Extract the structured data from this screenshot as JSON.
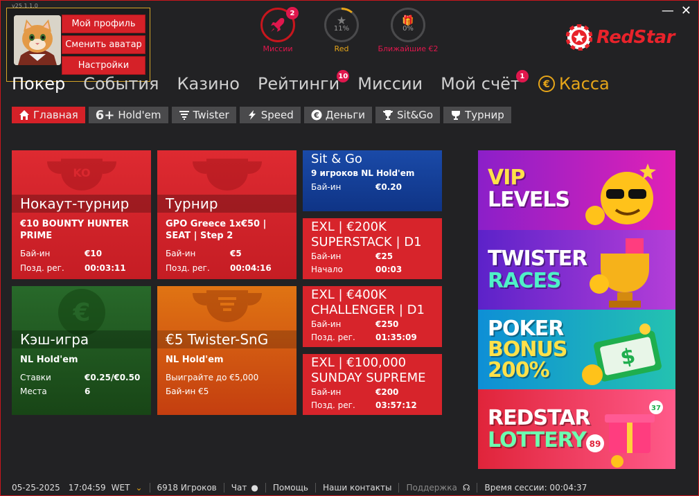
{
  "version": "v25.1.1.0",
  "profile": {
    "my_profile": "Мой профиль",
    "change_avatar": "Сменить аватар",
    "settings": "Настройки"
  },
  "top_stats": [
    {
      "label": "Миссии",
      "badge": "2",
      "color": "#e0174d"
    },
    {
      "label": "Red",
      "center": "11%",
      "progress": 0.11,
      "color": "#e6a519"
    },
    {
      "label": "Ближайшие €2",
      "center": "0%",
      "progress": 0.0,
      "color": "#e0174d"
    }
  ],
  "logo": "RedStar",
  "main_nav": {
    "poker": "Покер",
    "events": "События",
    "casino": "Казино",
    "ratings": "Рейтинги",
    "ratings_badge": "10",
    "missions": "Миссии",
    "account": "Мой счёт",
    "account_badge": "1",
    "kassa": "Касса"
  },
  "sub_nav": [
    "Главная",
    "Hold'em",
    "Twister",
    "Speed",
    "Деньги",
    "Sit&Go",
    "Турнир"
  ],
  "sub_nav_icons": [
    "home-icon",
    "six-plus-icon",
    "twister-icon",
    "lightning-icon",
    "euro-coin-icon",
    "trophy-icon",
    "cup-icon"
  ],
  "cards": {
    "knockout": {
      "title": "Нокаут-турнир",
      "sub": "€10 BOUNTY HUNTER PRIME",
      "rows": [
        {
          "k": "Бай-ин",
          "v": "€10"
        },
        {
          "k": "Позд. рег.",
          "v": "00:03:11"
        }
      ]
    },
    "tournament": {
      "title": "Турнир",
      "sub": "GPO Greece 1x€50 | SEAT | Step 2",
      "rows": [
        {
          "k": "Бай-ин",
          "v": "€5"
        },
        {
          "k": "Позд. рег.",
          "v": "00:04:16"
        }
      ]
    },
    "cash": {
      "title": "Кэш-игра",
      "sub": "NL Hold'em",
      "rows": [
        {
          "k": "Ставки",
          "v": "€0.25/€0.50"
        },
        {
          "k": "Места",
          "v": "6"
        }
      ]
    },
    "twister": {
      "title": "€5 Twister-SnG",
      "sub": "NL Hold'em",
      "line1": "Выиграйте до €5,000",
      "line2": "Бай-ин €5"
    }
  },
  "small_cards": [
    {
      "title": "Sit & Go",
      "sub": "9 игроков NL Hold'em",
      "rows": [
        {
          "k": "Бай-ин",
          "v": "€0.20"
        }
      ]
    },
    {
      "title": "EXL | €200K SUPERSTACK | D1",
      "rows": [
        {
          "k": "Бай-ин",
          "v": "€25"
        },
        {
          "k": "Начало",
          "v": "00:03"
        }
      ]
    },
    {
      "title": "EXL | €400K CHALLENGER | D1",
      "rows": [
        {
          "k": "Бай-ин",
          "v": "€250"
        },
        {
          "k": "Позд. рег.",
          "v": "01:35:09"
        }
      ]
    },
    {
      "title": "EXL | €100,000 SUNDAY SUPREME",
      "rows": [
        {
          "k": "Бай-ин",
          "v": "€200"
        },
        {
          "k": "Позд. рег.",
          "v": "03:57:12"
        }
      ]
    }
  ],
  "banners": [
    {
      "l1": "VIP",
      "l2": "LEVELS"
    },
    {
      "l1": "TWISTER",
      "l2": "RACES"
    },
    {
      "l1": "POKER",
      "l2": "BONUS",
      "l3": "200%"
    },
    {
      "l1": "REDSTAR",
      "l2": "LOTTERY"
    }
  ],
  "status": {
    "date": "05-25-2025",
    "time": "17:04:59",
    "tz": "WET",
    "players": "6918 Игроков",
    "chat": "Чат",
    "help": "Помощь",
    "contacts": "Наши контакты",
    "support": "Поддержка",
    "session": "Время сессии: 00:04:37"
  },
  "colors": {
    "accent_red": "#d52128",
    "gold": "#e6a519",
    "green_card": "#1f5a1a",
    "orange_card": "#cc4f12",
    "blue_card": "#143c98"
  }
}
